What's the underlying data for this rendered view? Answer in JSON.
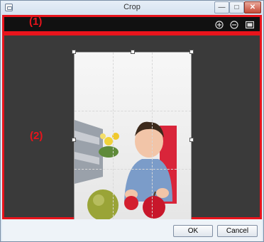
{
  "window": {
    "title": "Crop"
  },
  "title_buttons": {
    "minimize": "—",
    "maximize": "□",
    "close": "✕"
  },
  "callouts": {
    "toolbar": "(1)",
    "canvas": "(2)"
  },
  "toolbar": {
    "icons": [
      "zoom-in-icon",
      "zoom-out-icon",
      "fit-icon"
    ]
  },
  "buttons": {
    "ok": "OK",
    "cancel": "Cancel"
  },
  "colors": {
    "highlight": "#e8141c",
    "toolbar_bg": "#111111",
    "canvas_bg": "#3a3a3a"
  }
}
